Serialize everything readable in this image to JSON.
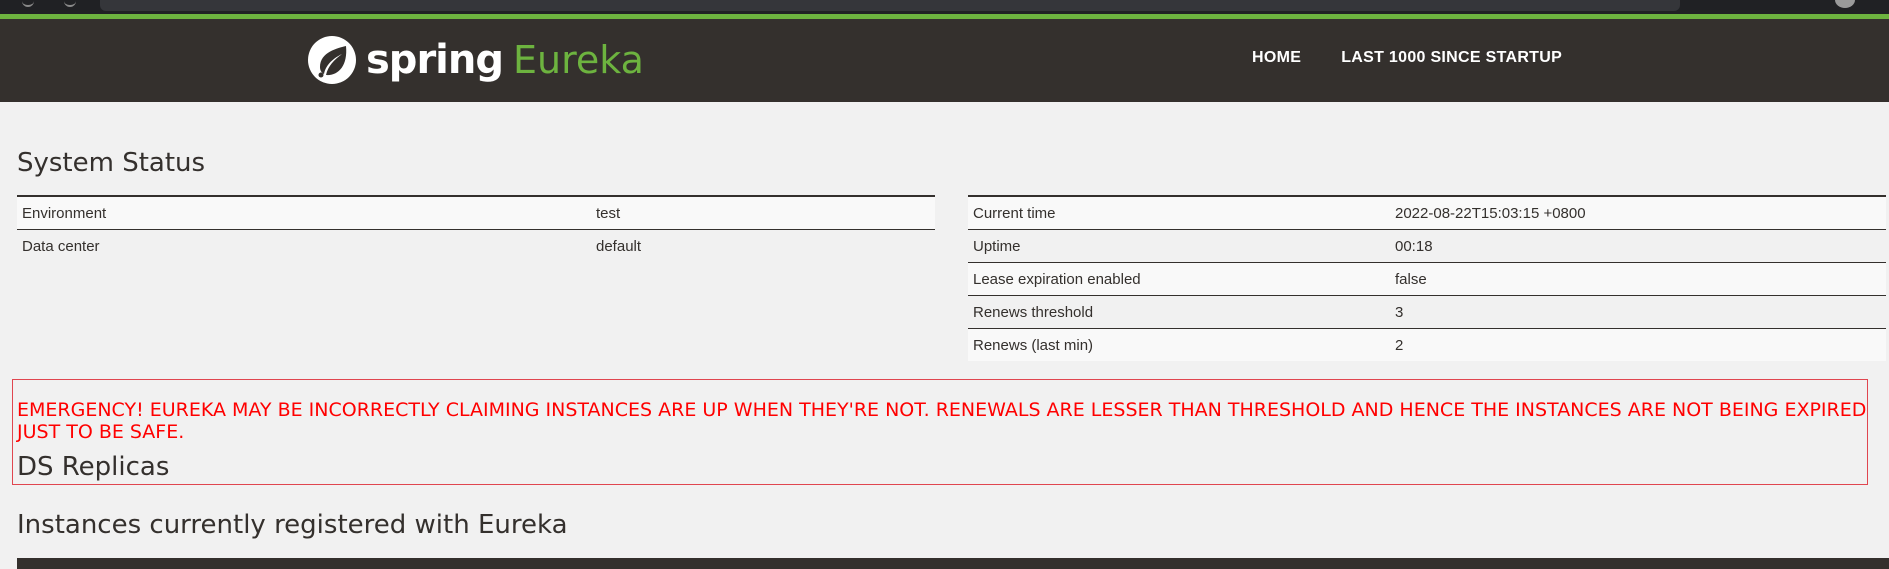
{
  "colors": {
    "brand_green": "#6db33f",
    "header_bg": "#34302d",
    "page_bg": "#f1f1f1",
    "emergency_red": "#ff0000"
  },
  "header": {
    "logo_spring": "spring",
    "logo_eureka": "Eureka",
    "logo_icon": "spring-leaf-icon",
    "nav": [
      {
        "label": "HOME"
      },
      {
        "label": "LAST 1000 SINCE STARTUP"
      }
    ]
  },
  "system_status": {
    "title": "System Status",
    "left_table": [
      {
        "label": "Environment",
        "value": "test"
      },
      {
        "label": "Data center",
        "value": "default"
      }
    ],
    "right_table": [
      {
        "label": "Current time",
        "value": "2022-08-22T15:03:15 +0800"
      },
      {
        "label": "Uptime",
        "value": "00:18"
      },
      {
        "label": "Lease expiration enabled",
        "value": "false"
      },
      {
        "label": "Renews threshold",
        "value": "3"
      },
      {
        "label": "Renews (last min)",
        "value": "2"
      }
    ]
  },
  "emergency": {
    "message": "EMERGENCY! EUREKA MAY BE INCORRECTLY CLAIMING INSTANCES ARE UP WHEN THEY'RE NOT. RENEWALS ARE LESSER THAN THRESHOLD AND HENCE THE INSTANCES ARE NOT BEING EXPIRED JUST TO BE SAFE."
  },
  "ds_replicas": {
    "title": "DS Replicas"
  },
  "instances": {
    "title": "Instances currently registered with Eureka"
  }
}
